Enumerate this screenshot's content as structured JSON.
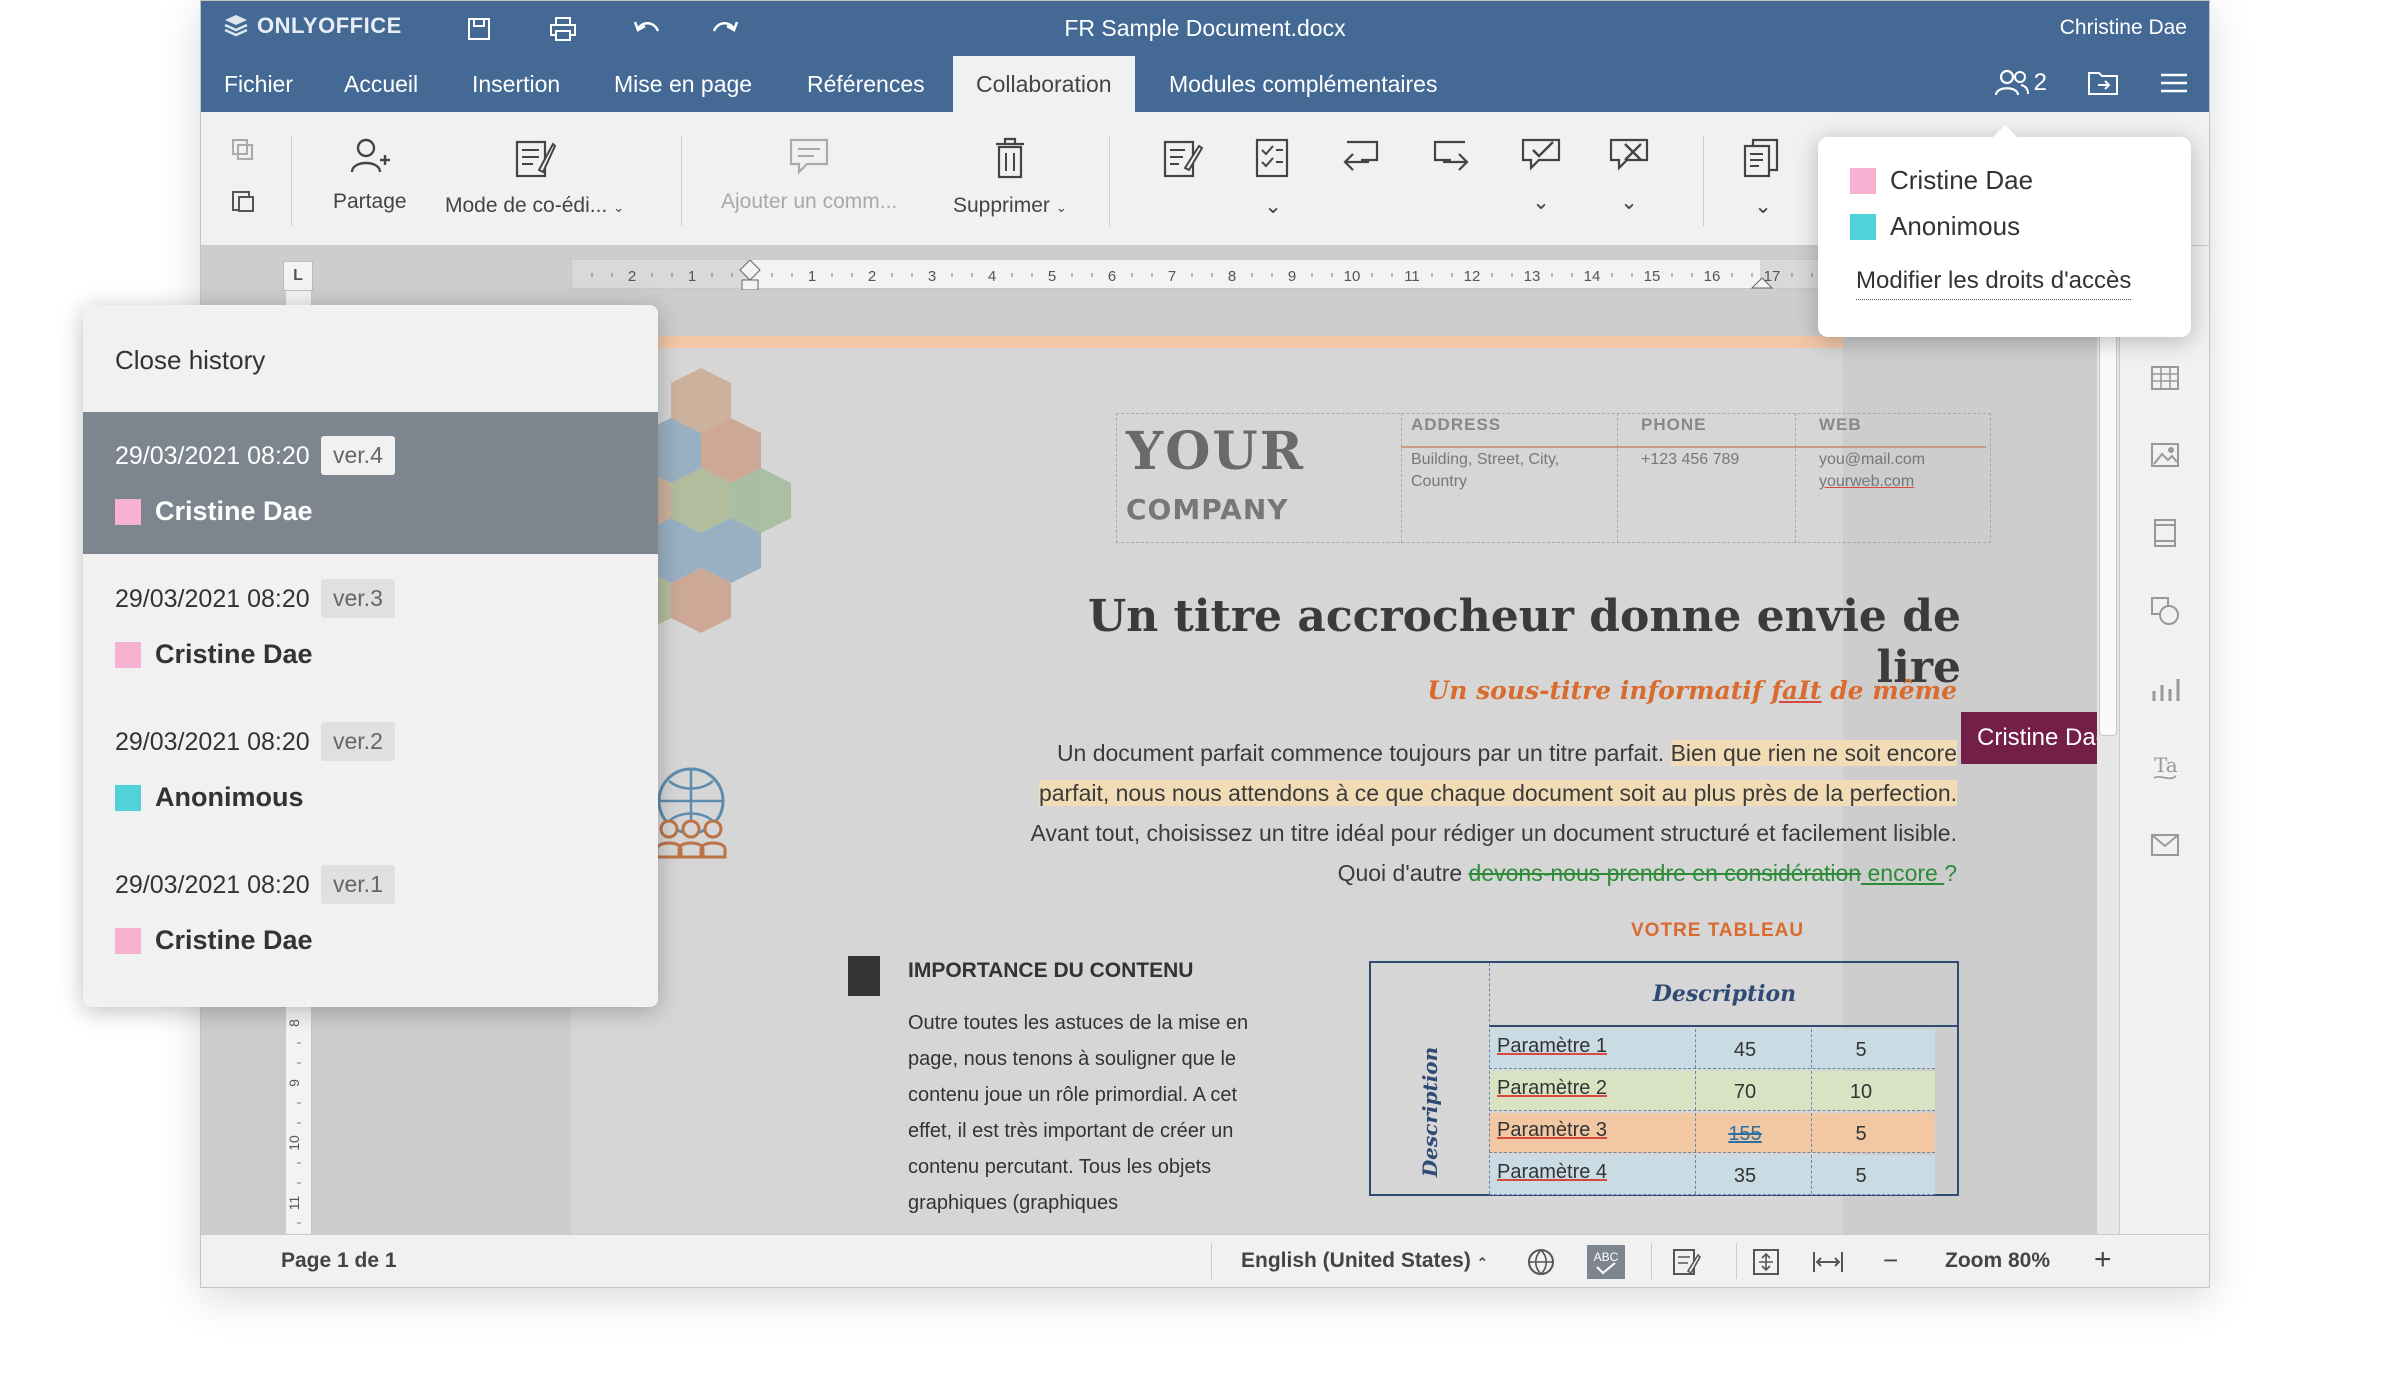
{
  "window": {
    "logo": "ONLYOFFICE",
    "doc_title": "FR Sample Document.docx",
    "user": "Christine Dae"
  },
  "menu": {
    "tabs": [
      "Fichier",
      "Accueil",
      "Insertion",
      "Mise en page",
      "Références",
      "Collaboration",
      "Modules complémentaires"
    ],
    "active_tab": "Collaboration",
    "users_count": "2"
  },
  "toolbar": {
    "share": "Partage",
    "coedit": "Mode de co-édi...",
    "add_comment": "Ajouter un comm...",
    "delete": "Supprimer"
  },
  "users_popup": {
    "users": [
      {
        "name": "Cristine Dae",
        "color": "#f7b1d1"
      },
      {
        "name": "Anonimous",
        "color": "#4fd3d8"
      }
    ],
    "link": "Modifier les droits d'accès"
  },
  "history": {
    "close": "Close history",
    "items": [
      {
        "date": "29/03/2021 08:20",
        "version": "ver.4",
        "user": "Cristine Dae",
        "color": "#f7b1d1",
        "selected": true
      },
      {
        "date": "29/03/2021 08:20",
        "version": "ver.3",
        "user": "Cristine Dae",
        "color": "#f7b1d1",
        "selected": false
      },
      {
        "date": "29/03/2021 08:20",
        "version": "ver.2",
        "user": "Anonimous",
        "color": "#4fd3d8",
        "selected": false
      },
      {
        "date": "29/03/2021 08:20",
        "version": "ver.1",
        "user": "Cristine Dae",
        "color": "#f7b1d1",
        "selected": false
      }
    ]
  },
  "document": {
    "your": "YOUR",
    "company": "COMPANY",
    "address_h": "ADDRESS",
    "address_1": "Building, Street, City,",
    "address_2": "Country",
    "phone_h": "PHONE",
    "phone": "+123 456 789",
    "web_h": "WEB",
    "web_1": "you@mail.com",
    "web_2": "yourweb.com",
    "title": "Un titre accrocheur donne envie de lire",
    "subtitle_a": "Un sous-titre informatif ",
    "subtitle_b": "faIt",
    "subtitle_c": " de même",
    "p_a": "Un document parfait commence toujours par un titre parfait. ",
    "p_hl": "Bien que rien ne soit encore parfait, nous nous attendons à ce que chaque document soit au plus près de la perfection.",
    "p_b": " Avant tout, choisissez un titre idéal pour rédiger un document structuré et facilement lisible. Quoi d'autre ",
    "p_del": "devons-nous prendre en considération",
    "p_ins": " encore ",
    "p_end": "?",
    "cursor_user": "Cristine Dae",
    "section_h": "IMPORTANCE DU CONTENU",
    "section_p": "Outre toutes les astuces de la mise en page, nous tenons à souligner que le contenu joue un rôle primordial. A cet effet, il est très important de créer un contenu percutant. Tous les objets graphiques (graphiques",
    "table_title": "VOTRE TABLEAU",
    "table_head": "Description",
    "table_rows": [
      {
        "name": "Paramètre 1",
        "a": "45",
        "b": "5",
        "bg": "#c9dbe3"
      },
      {
        "name": "Paramètre 2",
        "a": "70",
        "b": "10",
        "bg": "#d9e3c4"
      },
      {
        "name": "Paramètre 3",
        "a": "155",
        "b": "5",
        "bg": "#f1c7a4"
      },
      {
        "name": "Paramètre 4",
        "a": "35",
        "b": "5",
        "bg": "#c9dbe3"
      }
    ]
  },
  "status": {
    "page": "Page 1 de 1",
    "language": "English (United States)",
    "zoom": "Zoom 80%"
  }
}
